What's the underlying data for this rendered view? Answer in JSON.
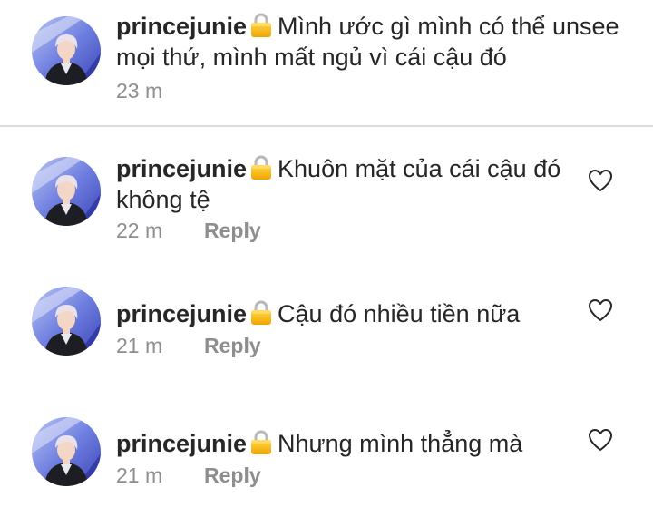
{
  "caption": {
    "username": "princejunie",
    "lock_icon": "lock-icon",
    "text": "Mình ước gì mình có thể unsee mọi thứ, mình mất ngủ vì cái cậu đó",
    "time": "23 m"
  },
  "comments": [
    {
      "username": "princejunie",
      "lock_icon": "lock-icon",
      "text": "Khuôn mặt của cái cậu đó không tệ",
      "time": "22 m",
      "reply_label": "Reply",
      "like_icon": "heart-outline-icon"
    },
    {
      "username": "princejunie",
      "lock_icon": "lock-icon",
      "text": "Cậu đó nhiều tiền nữa",
      "time": "21 m",
      "reply_label": "Reply",
      "like_icon": "heart-outline-icon"
    },
    {
      "username": "princejunie",
      "lock_icon": "lock-icon",
      "text": "Nhưng mình thẳng mà",
      "time": "21 m",
      "reply_label": "Reply",
      "like_icon": "heart-outline-icon"
    }
  ],
  "colors": {
    "text": "#262626",
    "secondary": "#8e8e8e",
    "divider": "#dbdbdb",
    "lock_gold": "#f4b400"
  }
}
